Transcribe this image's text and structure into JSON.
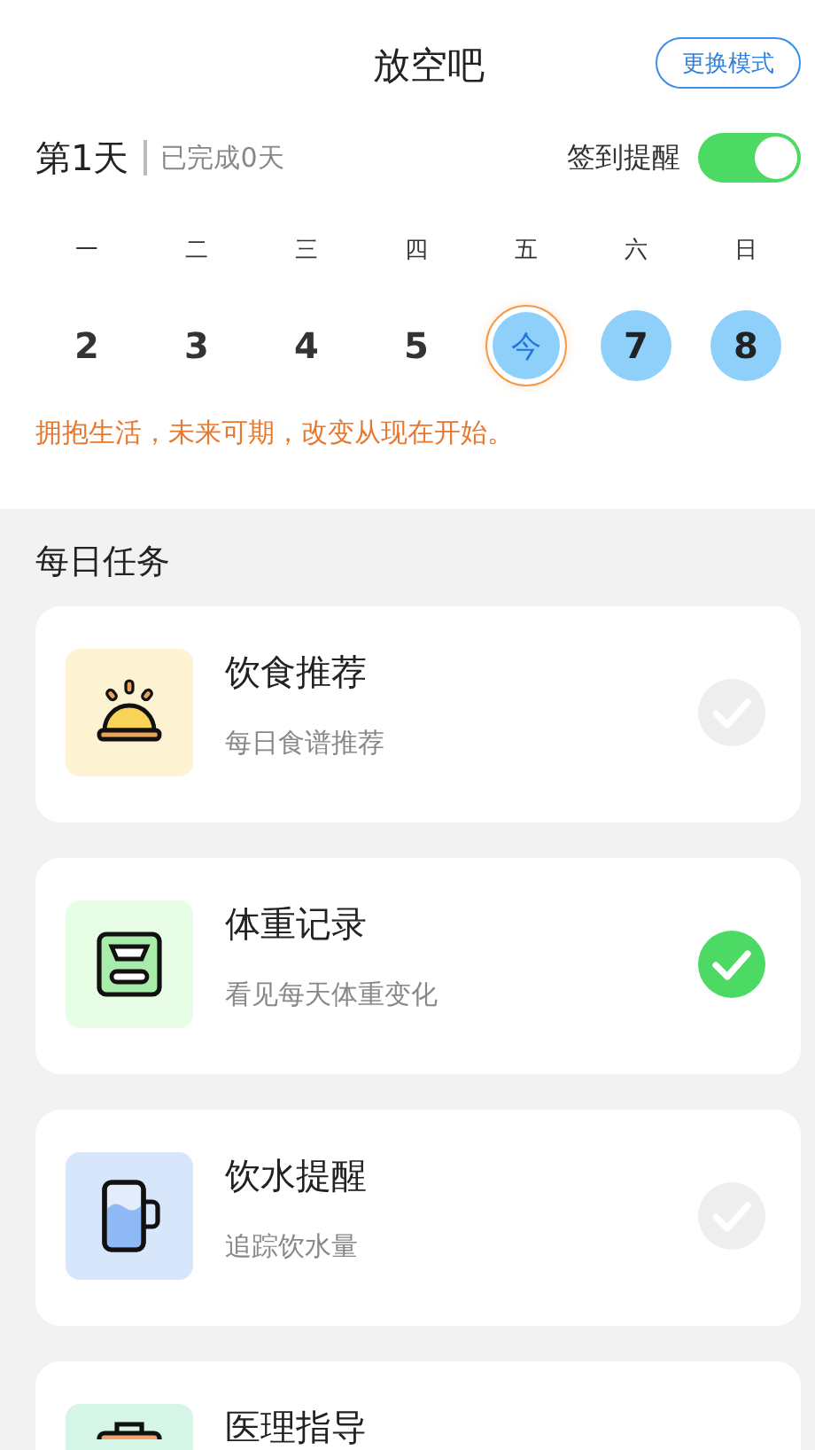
{
  "header": {
    "title": "放空吧",
    "mode_button": "更换模式"
  },
  "progress": {
    "day": "第1天",
    "completed": "已完成0天",
    "reminder_label": "签到提醒",
    "reminder_on": true
  },
  "week": {
    "weekdays": [
      "一",
      "二",
      "三",
      "四",
      "五",
      "六",
      "日"
    ],
    "days": [
      {
        "label": "2",
        "kind": "past"
      },
      {
        "label": "3",
        "kind": "past"
      },
      {
        "label": "4",
        "kind": "past"
      },
      {
        "label": "5",
        "kind": "past"
      },
      {
        "label": "今",
        "kind": "today"
      },
      {
        "label": "7",
        "kind": "future"
      },
      {
        "label": "8",
        "kind": "future"
      }
    ]
  },
  "motto": "拥抱生活，未来可期，改变从现在开始。",
  "tasks_title": "每日任务",
  "tasks": [
    {
      "kind": "food",
      "title": "饮食推荐",
      "subtitle": "每日食谱推荐",
      "done": false
    },
    {
      "kind": "weight",
      "title": "体重记录",
      "subtitle": "看见每天体重变化",
      "done": true
    },
    {
      "kind": "water",
      "title": "饮水提醒",
      "subtitle": "追踪饮水量",
      "done": false
    },
    {
      "kind": "medical",
      "title": "医理指导"
    }
  ]
}
